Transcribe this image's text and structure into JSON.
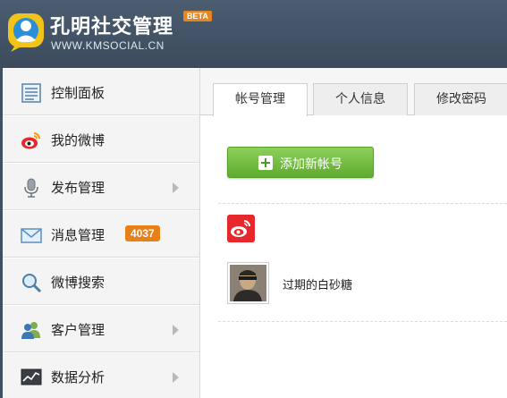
{
  "header": {
    "app_title": "孔明社交管理",
    "beta_badge": "BETA",
    "url": "WWW.KMSOCIAL.CN"
  },
  "sidebar": {
    "items": [
      {
        "label": "控制面板",
        "icon": "dashboard-icon"
      },
      {
        "label": "我的微博",
        "icon": "weibo-icon"
      },
      {
        "label": "发布管理",
        "icon": "microphone-icon",
        "has_submenu": true
      },
      {
        "label": "消息管理",
        "icon": "mail-icon",
        "badge": "4037"
      },
      {
        "label": "微博搜索",
        "icon": "magnifier-icon"
      },
      {
        "label": "客户管理",
        "icon": "users-icon",
        "has_submenu": true
      },
      {
        "label": "数据分析",
        "icon": "chart-icon",
        "has_submenu": true
      }
    ]
  },
  "tabs": [
    {
      "label": "帐号管理",
      "active": true
    },
    {
      "label": "个人信息",
      "active": false
    },
    {
      "label": "修改密码",
      "active": false
    }
  ],
  "main": {
    "add_button_label": "添加新帐号",
    "account_platform_icon": "sina-weibo-icon",
    "account_name": "过期的白砂糖"
  },
  "colors": {
    "header_bg": "#3f5061",
    "add_button": "#6db83a",
    "badge": "#e8801a",
    "weibo_red": "#e6282d"
  }
}
